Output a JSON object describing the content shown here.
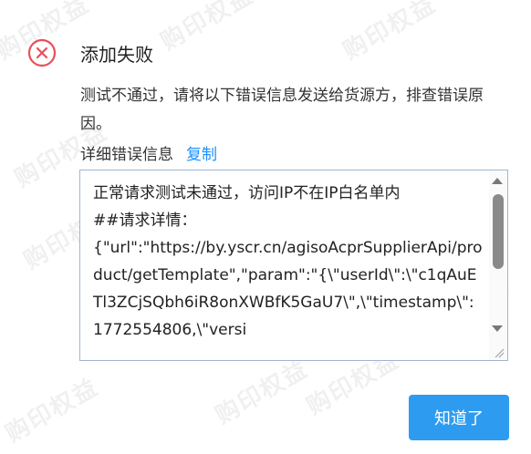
{
  "dialog": {
    "title": "添加失败",
    "description": "测试不通过，请将以下错误信息发送给货源方，排查错误原因。",
    "detail_label": "详细错误信息",
    "copy_label": "复制",
    "error_text": "正常请求测试未通过，访问IP不在IP白名单内\n##请求详情：\n{\"url\":\"https://by.yscr.cn/agisoAcprSupplierApi/product/getTemplate\",\"param\":\"{\\\"userId\\\":\\\"c1qAuETl3ZCjSQbh6iR8onXWBfK5GaU7\\\",\\\"timestamp\\\":1772554806,\\\"versi",
    "ok_button": "知道了"
  },
  "watermark_text": "购印权益",
  "colors": {
    "error_icon": "#e8505b",
    "link": "#1890ff",
    "primary_button": "#2d9cf0"
  },
  "icons": {
    "status": "close-circle-icon"
  }
}
